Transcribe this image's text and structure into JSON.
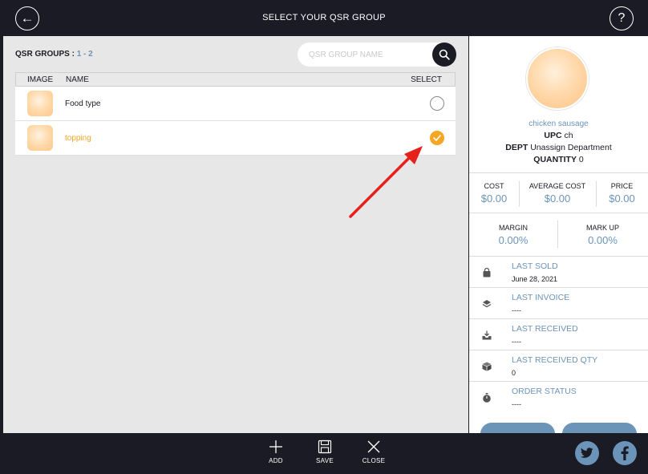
{
  "header": {
    "title": "SELECT YOUR QSR GROUP",
    "back_glyph": "←",
    "help_glyph": "?"
  },
  "groups": {
    "count_label": "QSR GROUPS : ",
    "pages": "1 - 2",
    "search_placeholder": "QSR GROUP NAME",
    "columns": {
      "image": "IMAGE",
      "name": "NAME",
      "select": "SELECT"
    },
    "rows": [
      {
        "name": "Food type",
        "selected": false
      },
      {
        "name": "topping",
        "selected": true
      }
    ]
  },
  "product": {
    "name": "chicken sausage",
    "upc_label": "UPC",
    "upc_value": "ch",
    "dept_label": "DEPT",
    "dept_value": "Unassign Department",
    "qty_label": "QUANTITY",
    "qty_value": "0",
    "cost_label": "COST",
    "cost_value": "$0.00",
    "avg_cost_label": "AVERAGE COST",
    "avg_cost_value": "$0.00",
    "price_label": "PRICE",
    "price_value": "$0.00",
    "margin_label": "MARGIN",
    "margin_value": "0.00%",
    "markup_label": "MARK UP",
    "markup_value": "0.00%",
    "info": [
      {
        "label": "LAST SOLD",
        "value": "June 28, 2021",
        "icon": "bag-icon"
      },
      {
        "label": "LAST INVOICE",
        "value": "----",
        "icon": "layers-icon"
      },
      {
        "label": "LAST RECEIVED",
        "value": "----",
        "icon": "tray-download-icon"
      },
      {
        "label": "LAST RECEIVED QTY",
        "value": "0",
        "icon": "box-icon"
      },
      {
        "label": "ORDER STATUS",
        "value": "----",
        "icon": "stopwatch-icon"
      }
    ]
  },
  "bottom": {
    "add": "ADD",
    "save": "SAVE",
    "close": "CLOSE"
  },
  "colors": {
    "dark": "#1b1b25",
    "accent_blue": "#6c94b8",
    "accent_orange": "#f5a623",
    "panel_gray": "#e7e7e7",
    "arrow_red": "#e8201c"
  }
}
